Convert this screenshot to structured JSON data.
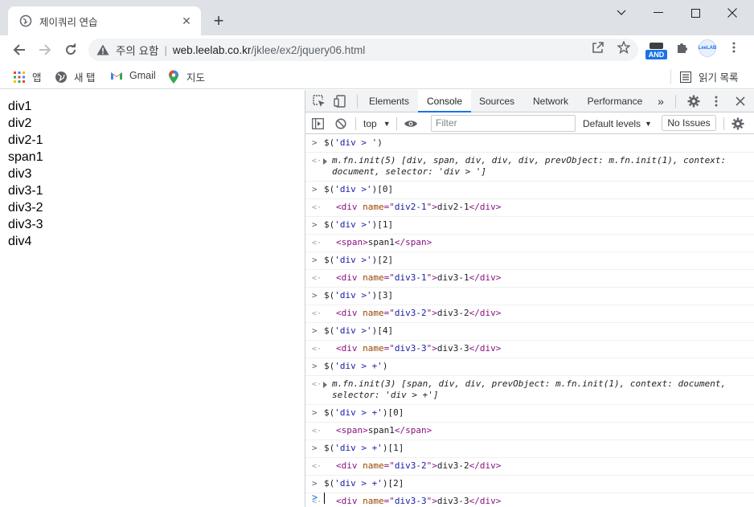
{
  "browser": {
    "tab_title": "제이쿼리 연습",
    "window_controls": [
      "chevron-down-icon",
      "minimize-icon",
      "maximize-icon",
      "close-icon"
    ],
    "security_text": "주의 요함",
    "url_host": "web.leelab.co.kr",
    "url_path": "/jklee/ex2/jquery06.html",
    "ext_badge": "AND",
    "profile_label": "LeeLAB",
    "bookmarks": [
      {
        "label": "앱",
        "icon": "apps-grid-icon"
      },
      {
        "label": "새 탭",
        "icon": "globe-icon"
      },
      {
        "label": "Gmail",
        "icon": "gmail-icon"
      },
      {
        "label": "지도",
        "icon": "maps-pin-icon"
      }
    ],
    "reading_list_label": "읽기 목록"
  },
  "page": {
    "lines": [
      "div1",
      "div2",
      "div2-1",
      "span1",
      "div3",
      "div3-1",
      "div3-2",
      "div3-3",
      "div4"
    ]
  },
  "devtools": {
    "tabs": [
      "Elements",
      "Console",
      "Sources",
      "Network",
      "Performance"
    ],
    "active_tab": "Console",
    "more_tabs": "»",
    "context": "top",
    "filter_placeholder": "Filter",
    "levels": "Default levels",
    "issues": "No Issues",
    "colors": {
      "accent": "#1a73e8",
      "tag": "#881280",
      "attr": "#994500",
      "string": "#1a1aa6"
    }
  },
  "console": {
    "entries": [
      {
        "cmd_pre": "$(",
        "cmd_str": "'div > '",
        "cmd_post": ")"
      },
      {
        "obj_lines": [
          "m.fn.init(5) [div, span, div, div, div, prevObject: m.fn.init(1), context:",
          "document, selector: 'div > ']"
        ]
      },
      {
        "cmd_pre": "$(",
        "cmd_str": "'div >'",
        "cmd_post": ")[0]"
      },
      {
        "el_attr": "name",
        "el_val": "div2-1",
        "el_text": "div2-1",
        "el_tag": "div"
      },
      {
        "cmd_pre": "$(",
        "cmd_str": "'div >'",
        "cmd_post": ")[1]"
      },
      {
        "el_text": "span1",
        "el_tag": "span"
      },
      {
        "cmd_pre": "$(",
        "cmd_str": "'div >'",
        "cmd_post": ")[2]"
      },
      {
        "el_attr": "name",
        "el_val": "div3-1",
        "el_text": "div3-1",
        "el_tag": "div"
      },
      {
        "cmd_pre": "$(",
        "cmd_str": "'div >'",
        "cmd_post": ")[3]"
      },
      {
        "el_attr": "name",
        "el_val": "div3-2",
        "el_text": "div3-2",
        "el_tag": "div"
      },
      {
        "cmd_pre": "$(",
        "cmd_str": "'div >'",
        "cmd_post": ")[4]"
      },
      {
        "el_attr": "name",
        "el_val": "div3-3",
        "el_text": "div3-3",
        "el_tag": "div"
      },
      {
        "cmd_pre": "$(",
        "cmd_str": "'div > +'",
        "cmd_post": ")"
      },
      {
        "obj_lines": [
          "m.fn.init(3) [span, div, div, prevObject: m.fn.init(1), context: document,",
          "selector: 'div > +']"
        ]
      },
      {
        "cmd_pre": "$(",
        "cmd_str": "'div > +'",
        "cmd_post": ")[0]"
      },
      {
        "el_text": "span1",
        "el_tag": "span"
      },
      {
        "cmd_pre": "$(",
        "cmd_str": "'div > +'",
        "cmd_post": ")[1]"
      },
      {
        "el_attr": "name",
        "el_val": "div3-2",
        "el_text": "div3-2",
        "el_tag": "div"
      },
      {
        "cmd_pre": "$(",
        "cmd_str": "'div > +'",
        "cmd_post": ")[2]"
      },
      {
        "el_attr": "name",
        "el_val": "div3-3",
        "el_text": "div3-3",
        "el_tag": "div"
      }
    ]
  }
}
